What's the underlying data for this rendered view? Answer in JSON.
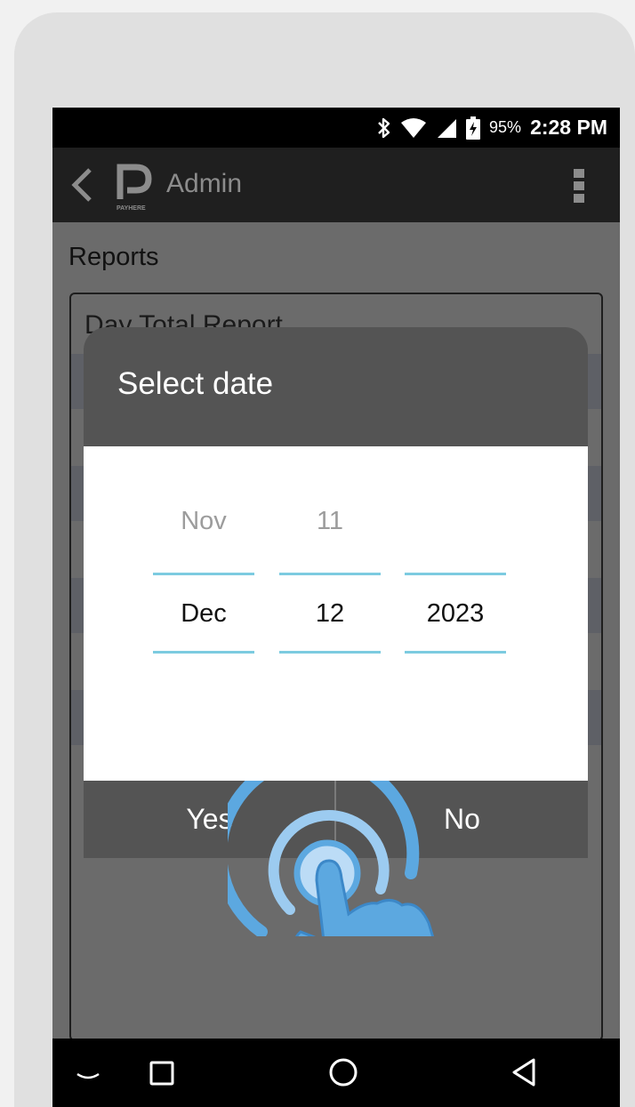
{
  "status_bar": {
    "battery": "95%",
    "time": "2:28 PM",
    "icons": [
      "bluetooth-icon",
      "wifi-icon",
      "signal-icon",
      "battery-charging-icon"
    ]
  },
  "app_bar": {
    "title": "Admin",
    "logo_text": "PAYHERE",
    "icons": [
      "back-icon",
      "overflow-menu-icon"
    ]
  },
  "content": {
    "section_title": "Reports",
    "report_title": "Day Total Report"
  },
  "date_dialog": {
    "title": "Select date",
    "month": {
      "previous": "Nov",
      "current": "Dec"
    },
    "day": {
      "previous": "11",
      "current": "12"
    },
    "year": {
      "previous": "",
      "current": "2023"
    },
    "yes_label": "Yes",
    "no_label": "No"
  },
  "nav_bar": {
    "icons": [
      "keyboard-hide-icon",
      "recents-icon",
      "home-icon",
      "back-triangle-icon"
    ]
  },
  "colors": {
    "accent_line": "#7ccbe0",
    "tap_indicator": "#5ca8e0",
    "dialog_header": "#545454",
    "scrim": "#6b6b6b"
  }
}
